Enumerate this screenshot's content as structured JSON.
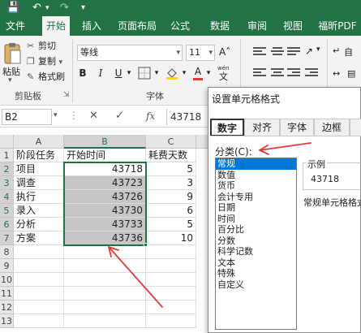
{
  "menu": {
    "tabs": [
      "文件",
      "开始",
      "插入",
      "页面布局",
      "公式",
      "数据",
      "审阅",
      "视图",
      "福昕PDF"
    ],
    "active_index": 1
  },
  "ribbon": {
    "paste_label": "粘贴",
    "cut_label": "剪切",
    "copy_label": "复制",
    "format_painter_label": "格式刷",
    "clipboard_group": "剪贴板",
    "font_name": "等线",
    "font_size": "11",
    "bold": "B",
    "italic": "I",
    "underline": "U",
    "font_color_letter": "A",
    "wen": "wén",
    "font_group": "字体",
    "auto_label": "自"
  },
  "formula_bar": {
    "name_box": "B2",
    "fx_label": "fx",
    "value": "43718"
  },
  "grid": {
    "columns": [
      "A",
      "B",
      "C"
    ],
    "rows": [
      "1",
      "2",
      "3",
      "4",
      "5",
      "6",
      "7",
      "8",
      "9",
      "10",
      "11",
      "12",
      "13"
    ],
    "header": [
      "阶段任务",
      "开始时间",
      "耗费天数"
    ],
    "data": [
      [
        "项目",
        "43718",
        "5"
      ],
      [
        "调查",
        "43723",
        "3"
      ],
      [
        "执行",
        "43726",
        "9"
      ],
      [
        "录入",
        "43730",
        "6"
      ],
      [
        "分析",
        "43733",
        "5"
      ],
      [
        "方案",
        "43736",
        "10"
      ]
    ]
  },
  "dialog": {
    "title": "设置单元格格式",
    "tabs": [
      "数字",
      "对齐",
      "字体",
      "边框"
    ],
    "active_tab": 0,
    "category_label": "分类(C):",
    "categories": [
      "常规",
      "数值",
      "货币",
      "会计专用",
      "日期",
      "时间",
      "百分比",
      "分数",
      "科学记数",
      "文本",
      "特殊",
      "自定义"
    ],
    "selected_category": 0,
    "preview_label": "示例",
    "preview_value": "43718",
    "description": "常规单元格格式"
  },
  "colors": {
    "accent": "#217346",
    "selection_highlight": "#0078d7",
    "annotation_arrow": "#e03a3a"
  }
}
